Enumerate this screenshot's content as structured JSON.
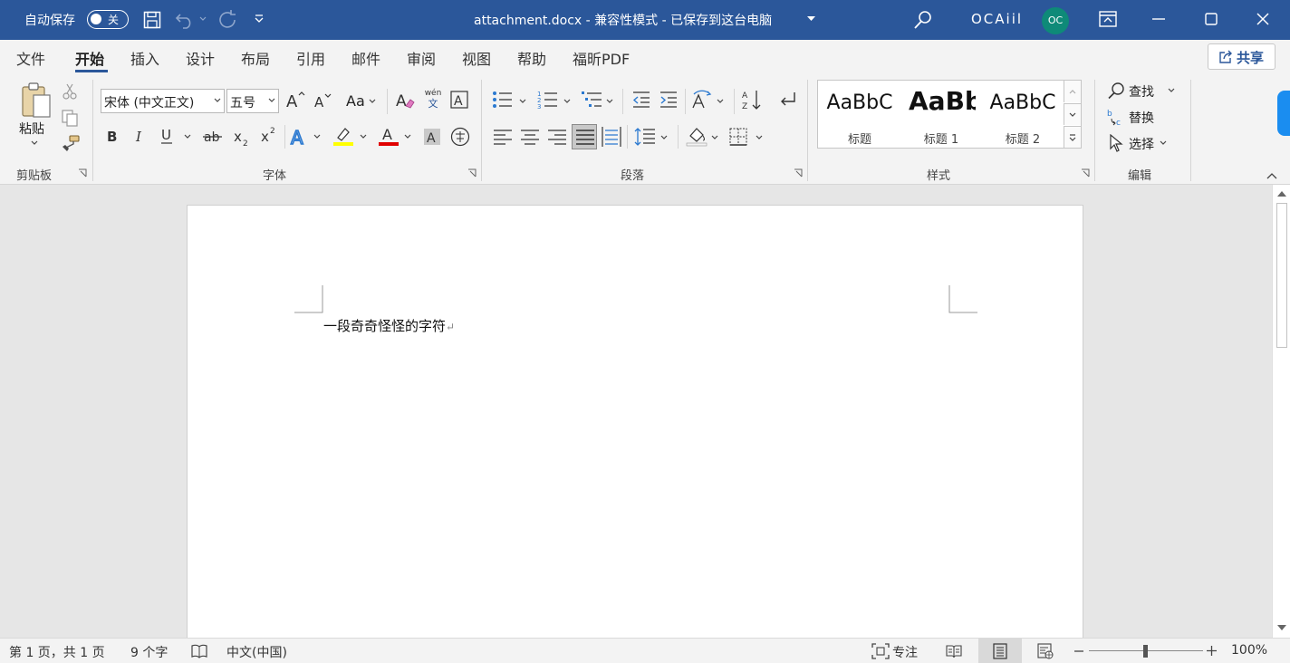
{
  "titlebar": {
    "autosave_label": "自动保存",
    "autosave_state": "关",
    "doc_title": "attachment.docx  -  兼容性模式  -  已保存到这台电脑",
    "user_name": "OCAiil",
    "avatar_initials": "OC"
  },
  "tabs": [
    "文件",
    "开始",
    "插入",
    "设计",
    "布局",
    "引用",
    "邮件",
    "审阅",
    "视图",
    "帮助",
    "福昕PDF"
  ],
  "active_tab": "开始",
  "share_label": "共享",
  "clipboard": {
    "paste_label": "粘贴",
    "group_label": "剪贴板"
  },
  "font": {
    "font_name": "宋体 (中文正文)",
    "font_size": "五号",
    "case_label": "Aa",
    "group_label": "字体",
    "phonetic_top": "wén",
    "phonetic_bottom": "文"
  },
  "paragraph": {
    "group_label": "段落"
  },
  "styles": {
    "group_label": "样式",
    "items": [
      {
        "sample": "AaBbC",
        "name": "标题"
      },
      {
        "sample": "AaBb",
        "name": "标题 1"
      },
      {
        "sample": "AaBbC",
        "name": "标题 2"
      }
    ]
  },
  "editing": {
    "group_label": "编辑",
    "find": "查找",
    "replace": "替换",
    "select": "选择"
  },
  "document": {
    "body_text": "一段奇奇怪怪的字符",
    "paragraph_mark": "↵"
  },
  "status": {
    "page": "第 1 页，共 1 页",
    "words": "9 个字",
    "language": "中文(中国)",
    "focus": "专注",
    "zoom": "100%"
  },
  "colors": {
    "titlebar": "#2b579a",
    "highlight": "#ffff00",
    "font_color": "#e00000"
  }
}
